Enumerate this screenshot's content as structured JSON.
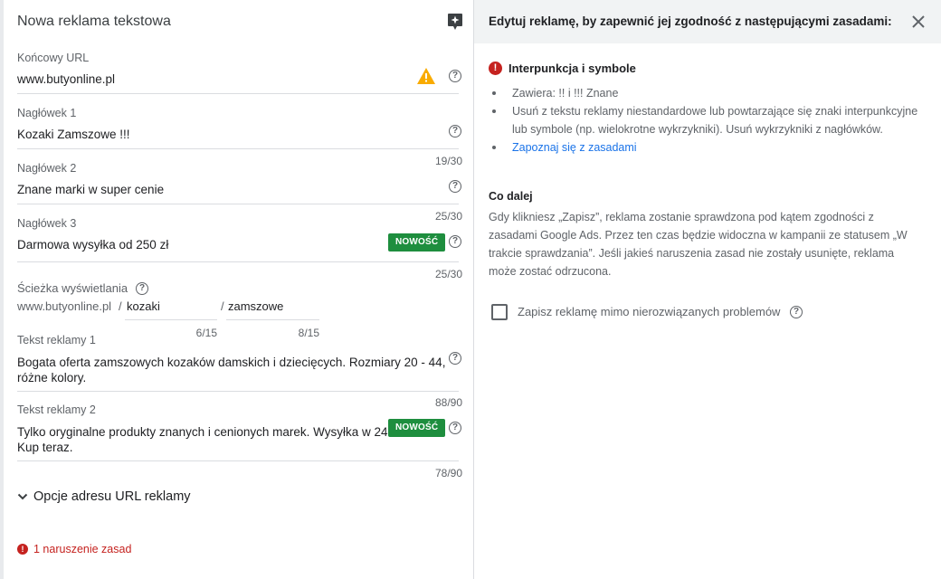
{
  "left_panel": {
    "title": "Nowa reklama tekstowa",
    "final_url": {
      "label": "Końcowy URL",
      "value": "www.butyonline.pl"
    },
    "headline1": {
      "label": "Nagłówek 1",
      "value": "Kozaki Zamszowe !!!",
      "counter": "19/30"
    },
    "headline2": {
      "label": "Nagłówek 2",
      "value": "Znane marki w super cenie",
      "counter": "25/30"
    },
    "headline3": {
      "label": "Nagłówek 3",
      "value": "Darmowa wysyłka od 250 zł",
      "badge": "NOWOŚĆ",
      "counter": "25/30"
    },
    "display_path": {
      "label": "Ścieżka wyświetlania",
      "domain": "www.butyonline.pl",
      "separator": "/",
      "path1": "kozaki",
      "path1_counter": "6/15",
      "path2": "zamszowe",
      "path2_counter": "8/15"
    },
    "description1": {
      "label": "Tekst reklamy 1",
      "line1": "Bogata oferta zamszowych kozaków damskich i dziecięcych. Rozmiary 20 - 44,",
      "line2": "różne kolory.",
      "counter": "88/90"
    },
    "description2": {
      "label": "Tekst reklamy 2",
      "line1": "Tylko oryginalne produkty znanych i cenionych marek. Wysyłka w 24h.",
      "line2": "Kup teraz.",
      "badge": "NOWOŚĆ",
      "counter": "78/90"
    },
    "url_options_label": "Opcje adresu URL reklamy",
    "violations_label": "1 naruszenie zasad",
    "help_glyph": "?"
  },
  "right_panel": {
    "title": "Edytuj reklamę, by zapewnić jej zgodność z następującymi zasadami:",
    "issue_title": "Interpunkcja i symbole",
    "bullets": [
      "Zawiera: !! i !!! Znane",
      "Usuń z tekstu reklamy niestandardowe lub powtarzające się znaki interpunkcyjne lub symbole (np. wielokrotne wykrzykniki). Usuń wykrzykniki z nagłówków."
    ],
    "policy_link": "Zapoznaj się z zasadami",
    "next_title": "Co dalej",
    "next_text": "Gdy klikniesz „Zapisz”, reklama zostanie sprawdzona pod kątem zgodności z zasadami Google Ads. Przez ten czas będzie widoczna w kampanii ze statusem „W trakcie sprawdzania”. Jeśli jakieś naruszenia zasad nie zostały usunięte, reklama może zostać odrzucona.",
    "checkbox_label": "Zapisz reklamę mimo nierozwiązanych problemów"
  },
  "icons": {
    "spark": "sparkle-icon",
    "warning": "warning-icon",
    "help": "help-icon",
    "close": "close-icon",
    "chevron": "chevron-down-icon",
    "error": "error-icon"
  },
  "colors": {
    "badge_green": "#1e8e3e",
    "error_red": "#c5221f",
    "warning_yellow": "#f9ab00",
    "link_blue": "#1a73e8"
  }
}
